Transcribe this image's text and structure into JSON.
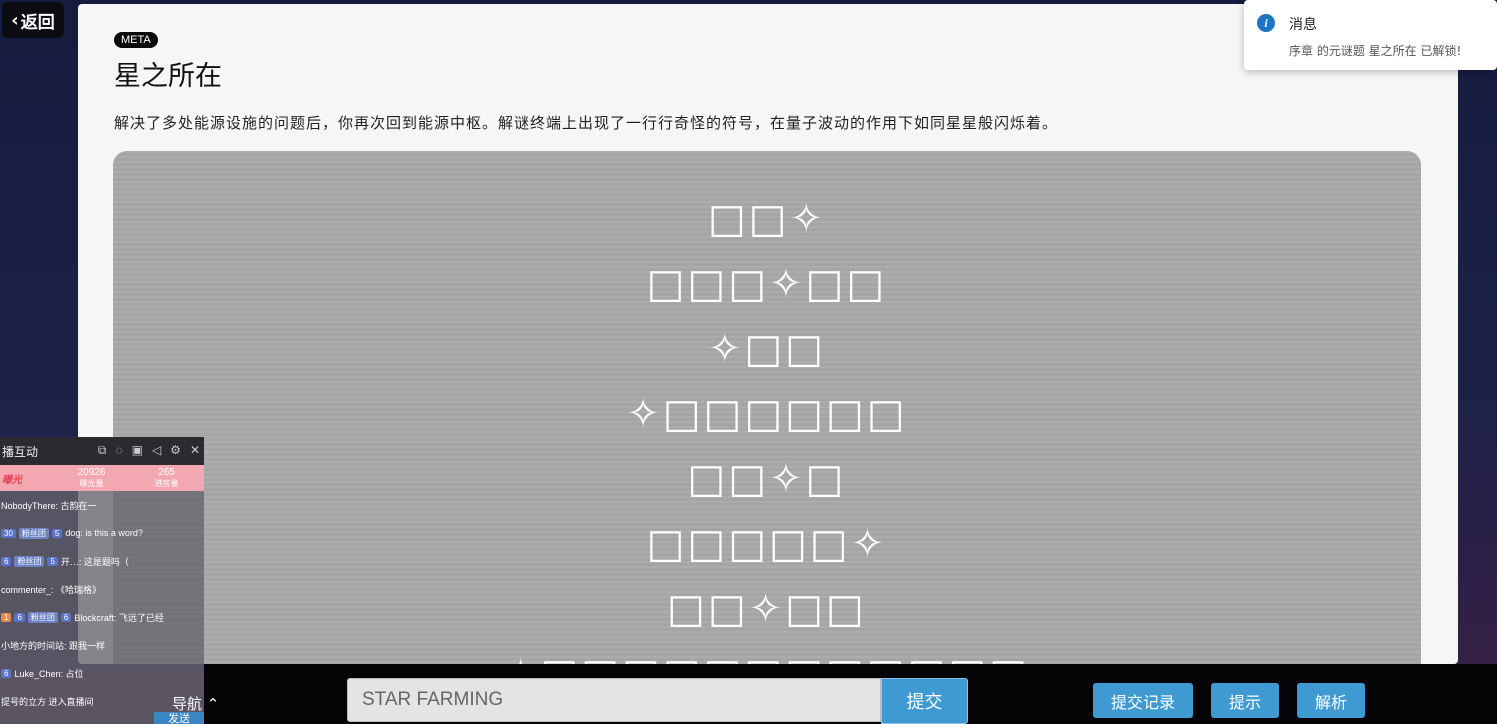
{
  "back": {
    "label": "返回"
  },
  "puzzle": {
    "tag": "META",
    "title": "星之所在",
    "description": "解决了多处能源设施的问题后，你再次回到能源中枢。解谜终端上出现了一行行奇怪的符号，在量子波动的作用下如同星星般闪烁着。",
    "rows": [
      "□□✧",
      "□□□✧□□",
      "✧□□",
      "✧□□□□□□",
      "□□✧□",
      "□□□□□✧",
      "□□✧□□",
      "✧□□□□□□□□□□□□"
    ]
  },
  "toast": {
    "title": "消息",
    "message": "序章 的元谜题 星之所在 已解锁!"
  },
  "chat": {
    "title": "播互动",
    "stats": {
      "label": "曝光",
      "views_value": "20926",
      "views_label": "曝光量",
      "enter_value": "265",
      "enter_label": "进房量"
    },
    "messages": [
      {
        "badges": [],
        "text": "NobodyThere: 古韵在一"
      },
      {
        "badges": [
          "30",
          "粉丝团",
          "5"
        ],
        "text": "dog: is this a word?"
      },
      {
        "badges": [
          "6",
          "粉丝团",
          "5"
        ],
        "text": "开…: 这是题吗（"
      },
      {
        "badges": [],
        "text": "commenter_: 《哈瑞格》"
      },
      {
        "badges": [
          "1",
          "6",
          "粉丝团",
          "6"
        ],
        "text": "Blockcraft: 飞远了已经"
      },
      {
        "badges": [],
        "text": "小地方的时间站: 跟我一样"
      },
      {
        "badges": [
          "6"
        ],
        "text": "Luke_Chen: 占位"
      },
      {
        "badges": [],
        "text": "提号的立方 进入直播间"
      }
    ],
    "send_label": "发送"
  },
  "nav": {
    "label": "导航"
  },
  "answer": {
    "value": "STAR FARMING",
    "submit_label": "提交"
  },
  "actions": {
    "history_label": "提交记录",
    "hint_label": "提示",
    "solution_label": "解析"
  }
}
